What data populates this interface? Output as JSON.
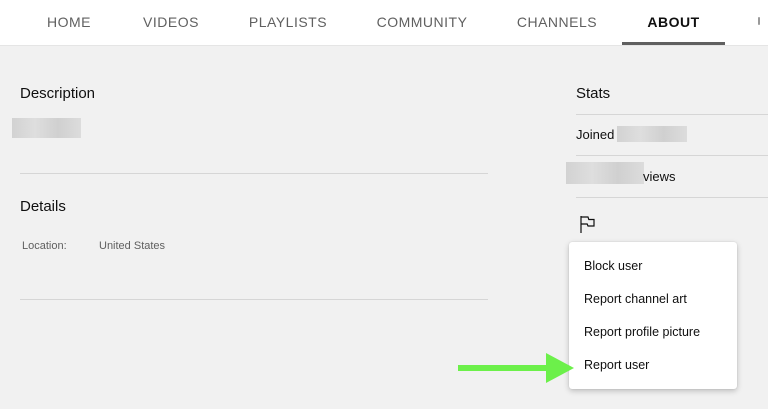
{
  "tabs": [
    {
      "label": "HOME"
    },
    {
      "label": "VIDEOS"
    },
    {
      "label": "PLAYLISTS"
    },
    {
      "label": "COMMUNITY"
    },
    {
      "label": "CHANNELS"
    },
    {
      "label": "ABOUT"
    }
  ],
  "active_tab": "ABOUT",
  "description": {
    "title": "Description"
  },
  "details": {
    "title": "Details",
    "location_label": "Location:",
    "location_value": "United States"
  },
  "stats": {
    "title": "Stats",
    "joined_label": "Joined",
    "views_suffix": "views"
  },
  "menu": {
    "items": [
      {
        "label": "Block user"
      },
      {
        "label": "Report channel art"
      },
      {
        "label": "Report profile picture"
      },
      {
        "label": "Report user"
      }
    ]
  },
  "colors": {
    "background": "#f1f1f1",
    "arrow": "#6cf04a",
    "active_underline": "#606060"
  },
  "icons": {
    "report": "flag-icon",
    "annotation": "arrow-right-icon"
  }
}
